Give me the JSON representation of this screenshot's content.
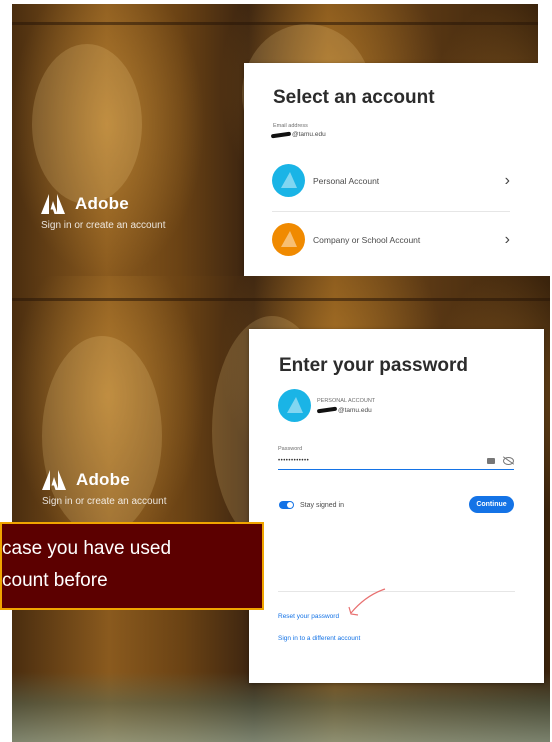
{
  "brand": {
    "name": "Adobe",
    "tagline": "Sign in or create an account"
  },
  "select_account": {
    "title": "Select an account",
    "email_label": "Email address",
    "email_visible": "@tamu.edu",
    "accounts": [
      {
        "label": "Personal Account",
        "color": "#1ab4e6"
      },
      {
        "label": "Company or School Account",
        "color": "#f08a00"
      }
    ]
  },
  "enter_password": {
    "title": "Enter your password",
    "account_type": "PERSONAL ACCOUNT",
    "email_visible": "@tamu.edu",
    "password_label": "Password",
    "password_value": "••••••••••••",
    "stay_signed_in": "Stay signed in",
    "stay_signed_in_enabled": true,
    "continue_label": "Continue",
    "reset_link": "Reset your password",
    "different_account_link": "Sign in to a different account"
  },
  "callout": {
    "line1": "case you have used",
    "line2": "count before"
  },
  "colors": {
    "accent": "#1473e6",
    "callout_bg": "#5c0000",
    "callout_border": "#f0a500",
    "annotation_arrow": "#e87070"
  }
}
